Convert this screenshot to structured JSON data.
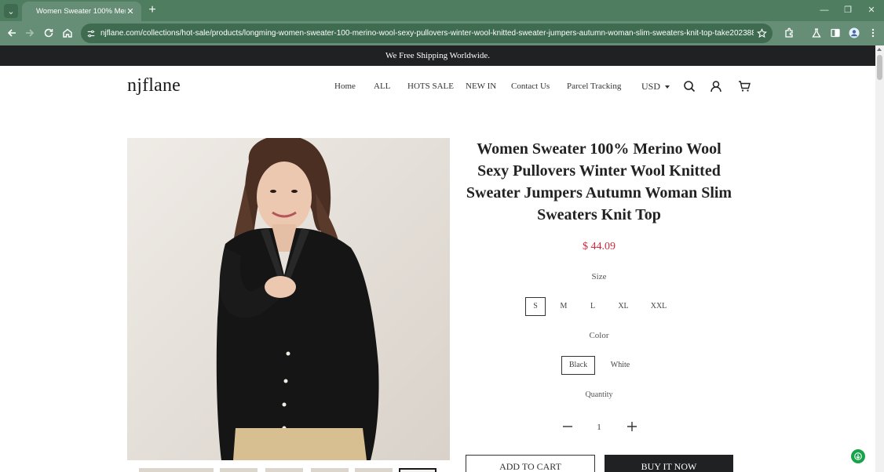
{
  "browser": {
    "tab_title": "Women Sweater 100% Merino",
    "url": "njflane.com/collections/hot-sale/products/longming-women-sweater-100-merino-wool-sexy-pullovers-winter-wool-knitted-sweater-jumpers-autumn-woman-slim-sweaters-knit-top-take2023888_e5fc62..."
  },
  "announcement": "We Free Shipping Worldwide.",
  "header": {
    "logo": "njflane",
    "nav": [
      "Home",
      "ALL",
      "HOTS SALE",
      "NEW IN",
      "Contact Us",
      "Parcel Tracking"
    ],
    "currency": "USD"
  },
  "product": {
    "title": "Women Sweater 100% Merino Wool Sexy Pullovers Winter Wool Knitted Sweater Jumpers Autumn Woman Slim Sweaters Knit Top",
    "price": "$ 44.09",
    "size_label": "Size",
    "sizes": [
      "S",
      "M",
      "L",
      "XL",
      "XXL"
    ],
    "selected_size": "S",
    "color_label": "Color",
    "colors": [
      "Black",
      "White"
    ],
    "selected_color": "Black",
    "quantity_label": "Quantity",
    "quantity": "1",
    "add_to_cart": "ADD TO CART",
    "buy_now": "BUY IT NOW"
  },
  "colors": {
    "chrome_tabbar": "#4e7d60",
    "chrome_toolbar": "#668e76",
    "announcement_bg": "#1f2123",
    "price": "#d3293e",
    "float_badge": "#17a34a"
  }
}
